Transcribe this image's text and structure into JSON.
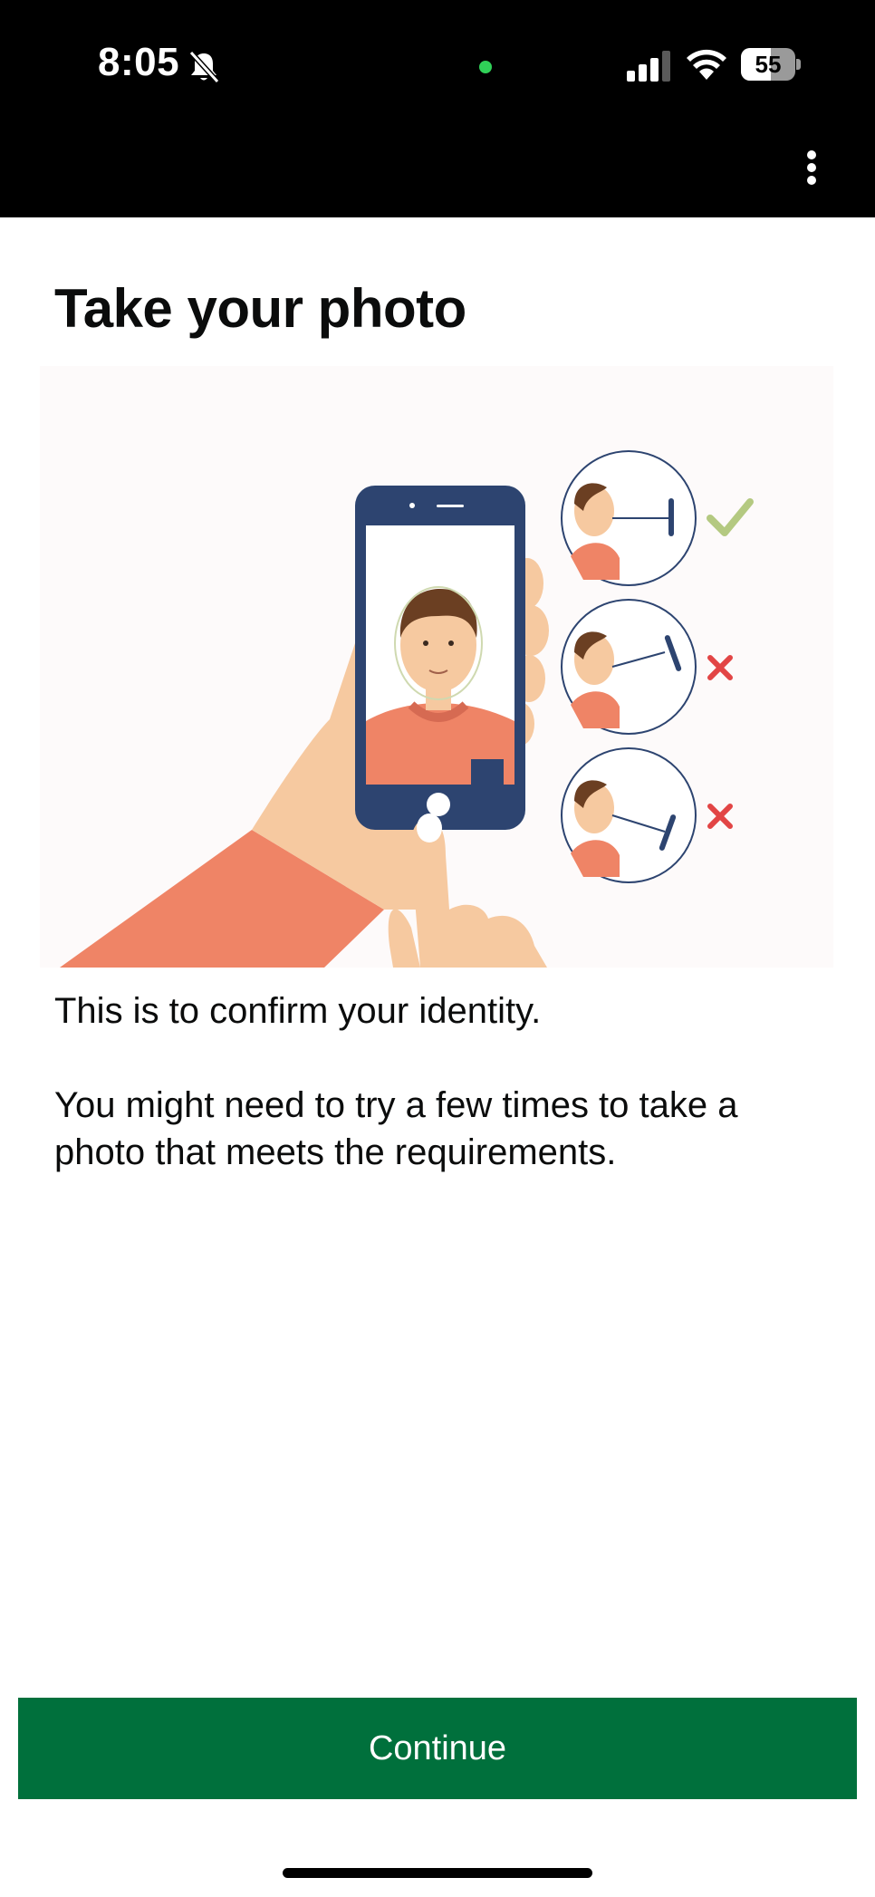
{
  "status_bar": {
    "time": "8:05",
    "battery_percent": "55",
    "battery_level": 0.55,
    "icons": [
      "bell-slash-icon",
      "camera-in-use-dot",
      "cellular-signal-icon",
      "wifi-icon",
      "battery-icon"
    ]
  },
  "header": {
    "menu_icon": "more-vertical-icon"
  },
  "main": {
    "title": "Take your photo",
    "illustration_icons": [
      "hand-holding-phone",
      "tick-icon",
      "cross-icon",
      "cross-icon"
    ],
    "paragraph_1": "This is to confirm your identity.",
    "paragraph_2": "You might need to try a few times to take a photo that meets the requirements."
  },
  "footer": {
    "continue_label": "Continue"
  },
  "colors": {
    "primary_button": "#00703c",
    "text": "#0b0c0c",
    "tick": "#b4c981",
    "cross": "#e24545",
    "phone": "#2d4470",
    "shirt": "#ef8466",
    "skin": "#f6c9a0"
  }
}
